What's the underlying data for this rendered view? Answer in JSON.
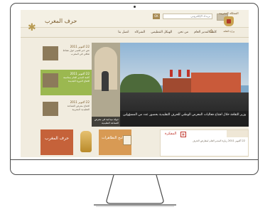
{
  "header": {
    "logo_text": "حرف المغرب",
    "crest_title": "المملكة المغربية",
    "crest_subtitle": "وزارة الثقافة",
    "search_placeholder": "بريدك الإلكتروني",
    "search_button": "OK"
  },
  "nav": {
    "items": [
      "كلمة المدير العام",
      "من نحن",
      "الهيكل التنظيمي",
      "الشركاء",
      "اتصل بنا"
    ]
  },
  "news": {
    "items": [
      {
        "date": "22 أكتوبر 2011",
        "text": "نص خبر قصير حول نشاط ثقافي في المغرب"
      },
      {
        "date": "22 أكتوبر 2011",
        "text": "كلمة المدير العام بمناسبة افتتاح الدورة الجديدة"
      },
      {
        "date": "22 أكتوبر 2011",
        "text": "افتتاح معرض الصناعة التقليدية المغربية"
      }
    ],
    "thumb_caption": "جولة ميدانية في معرض الصناعة التقليدية",
    "hero_caption": "وزير الثقافة خلال افتتاح فعاليات المعرض الوطني للحرف التقليدية بحضور عدد من المسؤولين"
  },
  "bottom": {
    "btn_m": "حرف المغرب",
    "btn_prog": "برنامج التظاهرات",
    "agenda_title": "المفكرة",
    "agenda_text": "22 أكتوبر 2011\nزيارة المدير العام لمعارض الحرف"
  }
}
